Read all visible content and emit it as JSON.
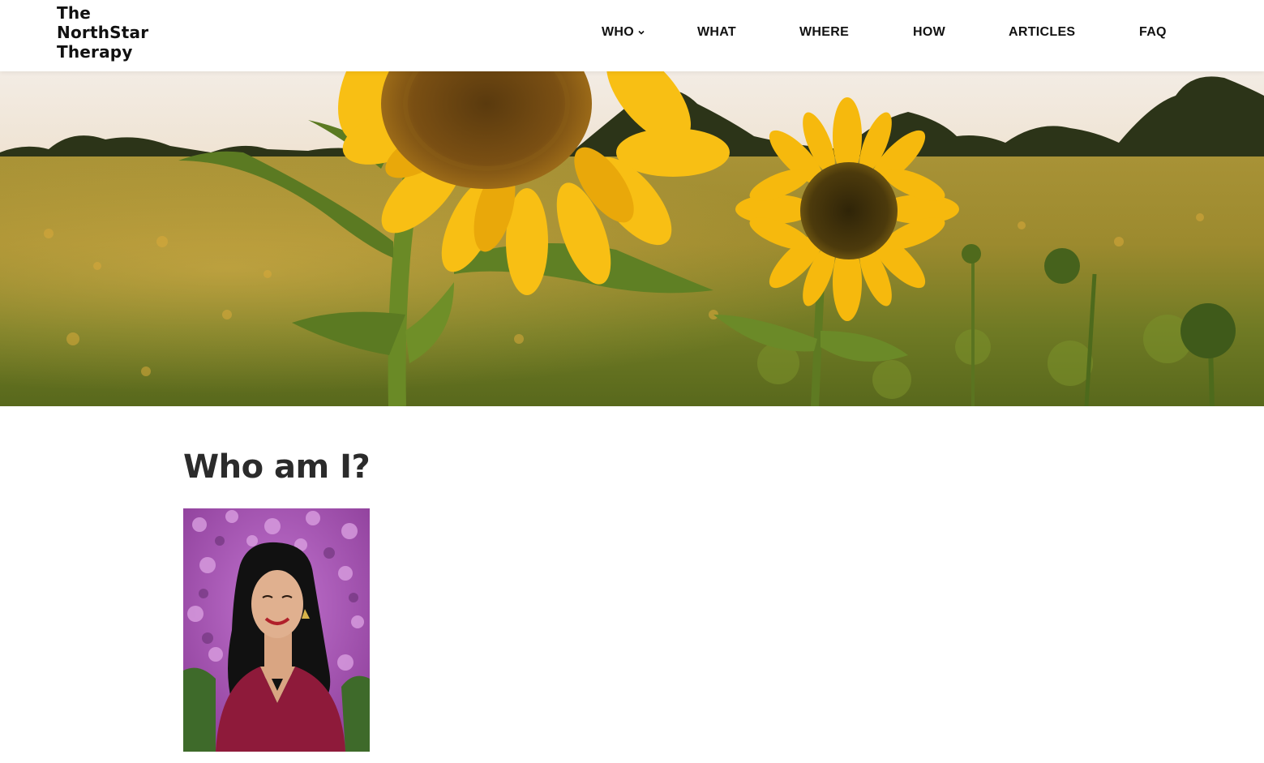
{
  "header": {
    "logo_lines": [
      "The",
      "NorthStar",
      "Therapy"
    ],
    "nav": [
      {
        "label": "WHO",
        "has_dropdown": true,
        "icon": "chevron-down-icon"
      },
      {
        "label": "WHAT"
      },
      {
        "label": "WHERE"
      },
      {
        "label": "HOW"
      },
      {
        "label": "ARTICLES"
      },
      {
        "label": "FAQ"
      }
    ]
  },
  "hero": {
    "image": "sunflower-field-photo"
  },
  "main": {
    "title": "Who am I?",
    "portrait": "therapist-portrait-photo"
  },
  "colors": {
    "text": "#111111",
    "heading": "#2b2b2b",
    "sunflower": "#f6b90d",
    "blouse": "#8e1a3a",
    "blossom": "#b25cc0"
  }
}
